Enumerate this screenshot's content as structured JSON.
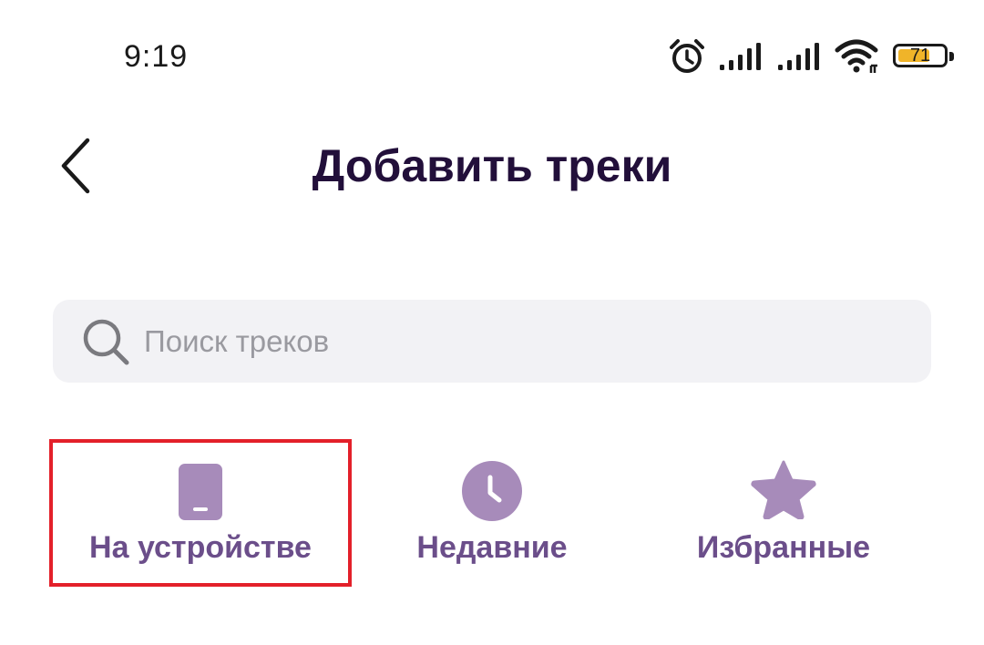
{
  "status_bar": {
    "time": "9:19",
    "battery": "71",
    "battery_level": 0.71,
    "icons": [
      "alarm-icon",
      "signal-icon",
      "signal-icon",
      "wifi-icon",
      "battery-icon"
    ]
  },
  "header": {
    "back_icon": "chevron-left-icon",
    "title": "Добавить треки"
  },
  "search": {
    "placeholder": "Поиск треков",
    "value": ""
  },
  "sources": [
    {
      "label": "На устройстве",
      "icon": "device-icon",
      "selected": true
    },
    {
      "label": "Недавние",
      "icon": "clock-icon",
      "selected": false
    },
    {
      "label": "Избранные",
      "icon": "star-icon",
      "selected": false
    }
  ],
  "colors": {
    "accent": "#a78bba",
    "tab_label": "#6b4e8a",
    "title": "#220f3a",
    "selection_border": "#e3202a",
    "search_bg": "#f2f2f5",
    "battery_fill": "#f0b429"
  }
}
